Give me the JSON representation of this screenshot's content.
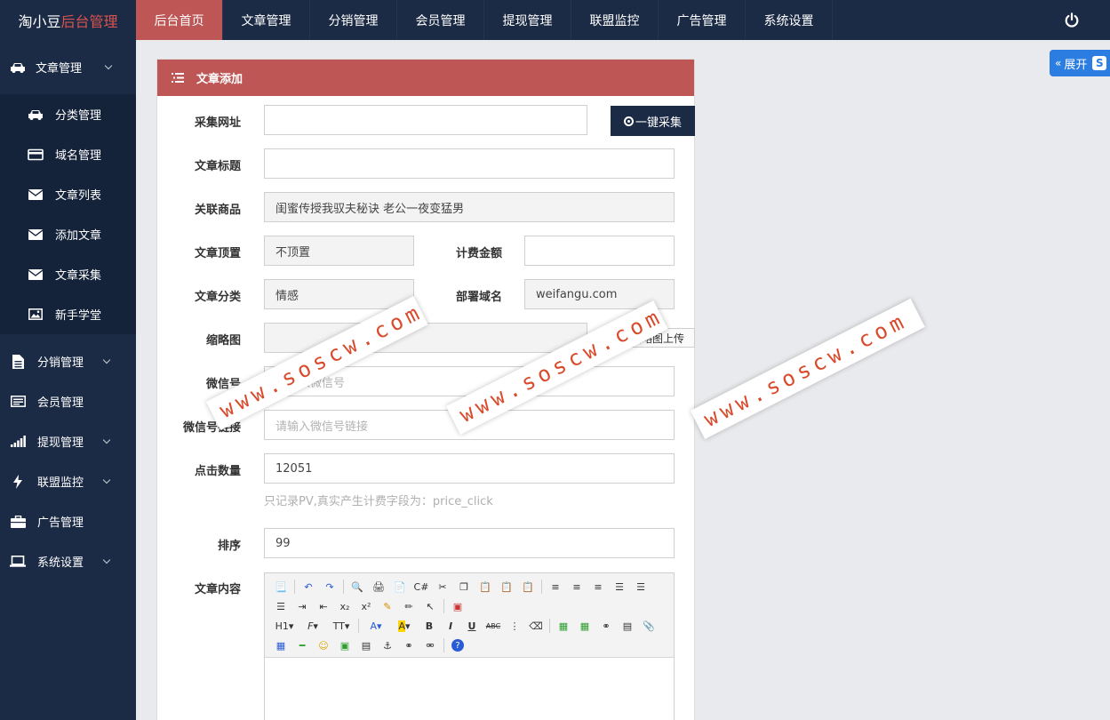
{
  "app": {
    "logo_main": "淘小豆",
    "logo_accent": "后台管理"
  },
  "topnav": [
    {
      "label": "后台首页",
      "active": true
    },
    {
      "label": "文章管理"
    },
    {
      "label": "分销管理"
    },
    {
      "label": "会员管理"
    },
    {
      "label": "提现管理"
    },
    {
      "label": "联盟监控"
    },
    {
      "label": "广告管理"
    },
    {
      "label": "系统设置"
    }
  ],
  "sidebar": {
    "article_group": "文章管理",
    "sub": [
      "分类管理",
      "域名管理",
      "文章列表",
      "添加文章",
      "文章采集",
      "新手学堂"
    ],
    "items": [
      "分销管理",
      "会员管理",
      "提现管理",
      "联盟监控",
      "广告管理",
      "系统设置"
    ]
  },
  "panel": {
    "title": "文章添加",
    "labels": {
      "url": "采集网址",
      "title": "文章标题",
      "product": "关联商品",
      "top": "文章顶置",
      "fee": "计费金额",
      "category": "文章分类",
      "domain": "部署域名",
      "thumb": "缩略图",
      "wechat": "微信号",
      "wechat_link": "微信号链接",
      "clicks": "点击数量",
      "sort": "排序",
      "content": "文章内容"
    },
    "values": {
      "url": "",
      "title": "",
      "product": "闺蜜传授我驭夫秘诀 老公一夜变猛男",
      "top": "不顶置",
      "fee": "",
      "category": "情感",
      "domain": "weifangu.com",
      "thumb": "",
      "clicks": "12051",
      "sort": "99"
    },
    "placeholders": {
      "wechat": "请输入微信号",
      "wechat_link": "请输入微信号链接"
    },
    "collect_button": "一键采集",
    "upload_button": "缩略图上传",
    "hint": "只记录PV,真实产生计费字段为：price_click"
  },
  "expand": {
    "label": "展开"
  },
  "watermark": "www.soscw.com",
  "colors": {
    "nav_bg": "#1c2b45",
    "accent": "#bf5656",
    "expand": "#2b7de1"
  }
}
